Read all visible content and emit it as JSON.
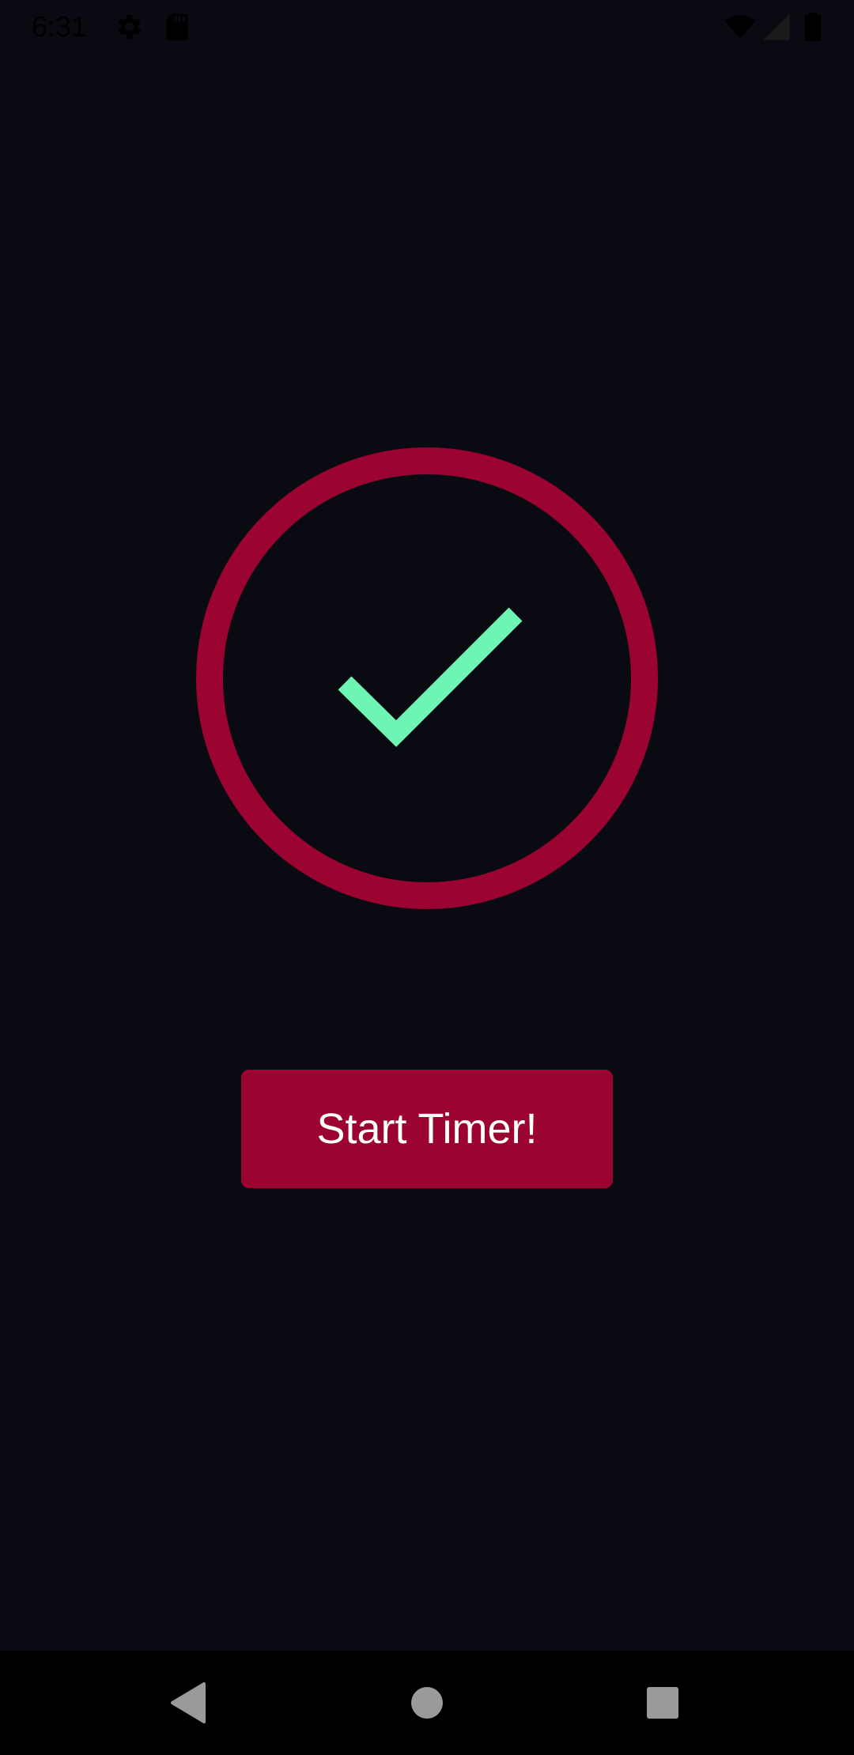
{
  "status_bar": {
    "time": "6:31",
    "icons": [
      "gear-icon",
      "sd-card-icon",
      "wifi-icon",
      "signal-icon",
      "battery-icon"
    ]
  },
  "indicator": {
    "ring_color": "#9b0330",
    "check_color": "#6ef5b4",
    "icon": "checkmark-icon"
  },
  "start_button": {
    "label": "Start Timer!",
    "color": "#9b0330"
  },
  "nav_bar": {
    "buttons": [
      "back-icon",
      "home-icon",
      "recents-icon"
    ],
    "icon_color": "#9a9a9a"
  },
  "colors": {
    "background": "#0a0a12"
  }
}
